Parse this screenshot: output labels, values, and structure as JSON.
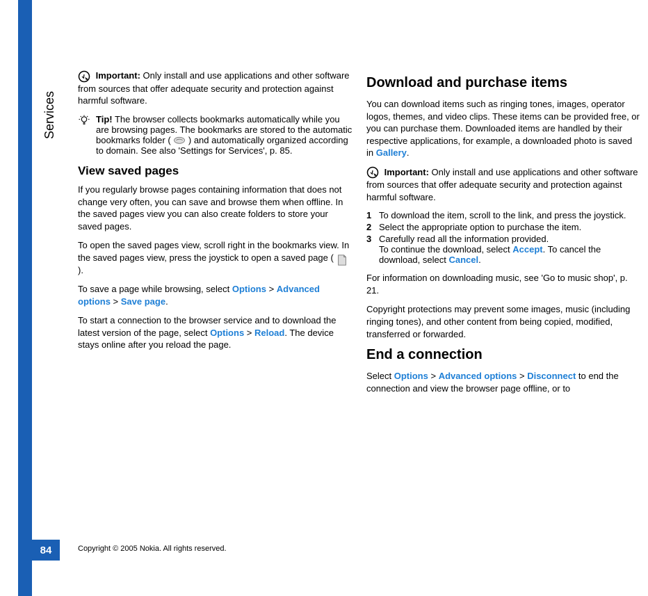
{
  "sidebar": {
    "section_label": "Services",
    "page_number": "84"
  },
  "copyright": "Copyright © 2005 Nokia. All rights reserved.",
  "left": {
    "important_label": "Important:",
    "important_text": " Only install and use applications and other software from sources that offer adequate security and protection against harmful software.",
    "tip_label": "Tip!",
    "tip_text": " The browser collects bookmarks automatically while you are browsing pages. The bookmarks are stored to the automatic bookmarks folder ( ",
    "tip_text2": " ) and automatically organized according to domain. See also 'Settings for Services', p. 85.",
    "heading_view_saved": "View saved pages",
    "p1": "If you regularly browse pages containing information that does not change very often, you can save and browse them when offline. In the saved pages view you can also create folders to store your saved pages.",
    "p2a": "To open the saved pages view, scroll right in the bookmarks view. In the saved pages view, press the joystick to open a saved page ( ",
    "p2b": " ).",
    "p3a": "To save a page while browsing, select ",
    "options": "Options",
    "gt": " > ",
    "advanced_options": "Advanced options",
    "save_page": "Save page",
    "period": ".",
    "p4a": "To start a connection to the browser service and to download the latest version of the page, select ",
    "reload": "Reload",
    "p4b": ". The device stays online after you reload the page."
  },
  "right": {
    "heading_download": "Download and purchase items",
    "p1a": "You can download items such as ringing tones, images, operator logos, themes, and video clips. These items can be provided free, or you can purchase them. Downloaded items are handled by their respective applications, for example, a downloaded photo is saved in ",
    "gallery": "Gallery",
    "period": ".",
    "important_label": "Important:",
    "important_text": " Only install and use applications and other software from sources that offer adequate security and protection against harmful software.",
    "step1_num": "1",
    "step1": "To download the item, scroll to the link, and press the joystick.",
    "step2_num": "2",
    "step2": "Select the appropriate option to purchase the item.",
    "step3_num": "3",
    "step3a": "Carefully read all the information provided.",
    "step3b_a": "To continue the download, select ",
    "accept": "Accept",
    "step3b_b": ". To cancel the download, select ",
    "cancel": "Cancel",
    "p2": "For information on downloading music, see 'Go to music shop', p. 21.",
    "p3": "Copyright protections may prevent some images, music (including ringing tones), and other content from being copied, modified, transferred or forwarded.",
    "heading_end": "End a connection",
    "p4a": "Select ",
    "options": "Options",
    "gt": " > ",
    "advanced_options": "Advanced options",
    "disconnect": "Disconnect",
    "p4b": " to end the connection and view the browser page offline, or to"
  }
}
